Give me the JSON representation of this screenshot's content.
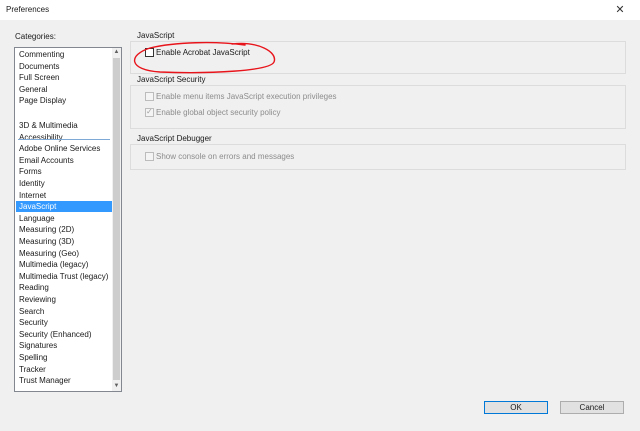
{
  "window": {
    "title": "Preferences",
    "close_glyph": "✕"
  },
  "categories": {
    "label": "Categories:",
    "items": [
      "Commenting",
      "Documents",
      "Full Screen",
      "General",
      "Page Display",
      "3D & Multimedia",
      "Accessibility",
      "Adobe Online Services",
      "Email Accounts",
      "Forms",
      "Identity",
      "Internet",
      "JavaScript",
      "Language",
      "Measuring (2D)",
      "Measuring (3D)",
      "Measuring (Geo)",
      "Multimedia (legacy)",
      "Multimedia Trust (legacy)",
      "Reading",
      "Reviewing",
      "Search",
      "Security",
      "Security (Enhanced)",
      "Signatures",
      "Spelling",
      "Tracker",
      "Trust Manager"
    ],
    "selected": "JavaScript"
  },
  "javascript": {
    "title": "JavaScript",
    "enable_label": "Enable Acrobat JavaScript",
    "enable_checked": false
  },
  "security": {
    "title": "JavaScript Security",
    "menu_items_label": "Enable menu items JavaScript execution privileges",
    "menu_items_checked": false,
    "global_policy_label": "Enable global object security policy",
    "global_policy_checked": true
  },
  "debugger": {
    "title": "JavaScript Debugger",
    "console_label": "Show console on errors and messages",
    "console_checked": false
  },
  "buttons": {
    "ok": "OK",
    "cancel": "Cancel"
  },
  "colors": {
    "selection": "#3399ff",
    "annotation": "#e8141b"
  }
}
